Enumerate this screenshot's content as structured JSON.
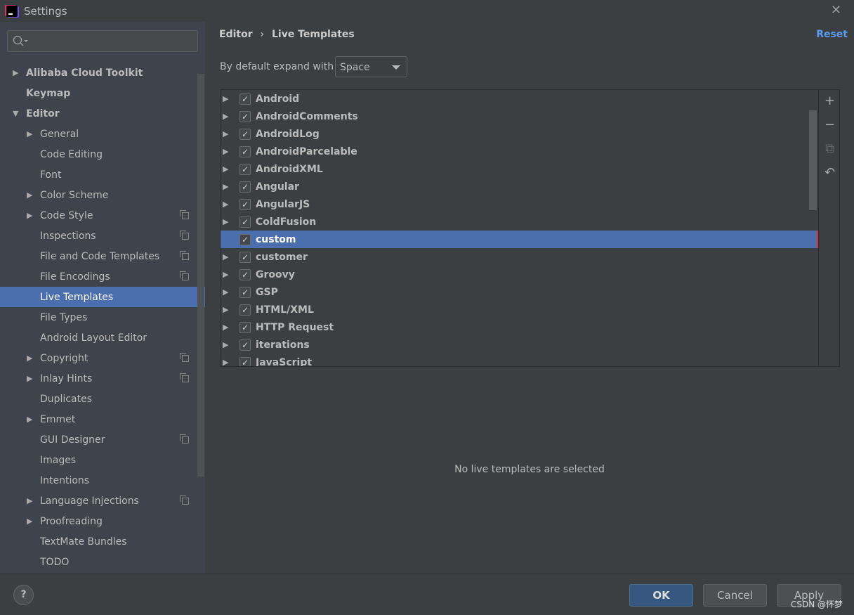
{
  "window": {
    "title": "Settings",
    "close_icon": "close-icon"
  },
  "sidebar": {
    "search_placeholder": "",
    "items": [
      {
        "label": "Alibaba Cloud Toolkit",
        "level": 0,
        "arrow": "right",
        "bold": true
      },
      {
        "label": "Keymap",
        "level": 0,
        "arrow": "",
        "bold": true
      },
      {
        "label": "Editor",
        "level": 0,
        "arrow": "down",
        "bold": true
      },
      {
        "label": "General",
        "level": 1,
        "arrow": "right"
      },
      {
        "label": "Code Editing",
        "level": 1,
        "arrow": ""
      },
      {
        "label": "Font",
        "level": 1,
        "arrow": ""
      },
      {
        "label": "Color Scheme",
        "level": 1,
        "arrow": "right"
      },
      {
        "label": "Code Style",
        "level": 1,
        "arrow": "right",
        "copy": true
      },
      {
        "label": "Inspections",
        "level": 1,
        "arrow": "",
        "copy": true
      },
      {
        "label": "File and Code Templates",
        "level": 1,
        "arrow": "",
        "copy": true
      },
      {
        "label": "File Encodings",
        "level": 1,
        "arrow": "",
        "copy": true
      },
      {
        "label": "Live Templates",
        "level": 1,
        "arrow": "",
        "selected": true
      },
      {
        "label": "File Types",
        "level": 1,
        "arrow": ""
      },
      {
        "label": "Android Layout Editor",
        "level": 1,
        "arrow": ""
      },
      {
        "label": "Copyright",
        "level": 1,
        "arrow": "right",
        "copy": true
      },
      {
        "label": "Inlay Hints",
        "level": 1,
        "arrow": "right",
        "copy": true
      },
      {
        "label": "Duplicates",
        "level": 1,
        "arrow": ""
      },
      {
        "label": "Emmet",
        "level": 1,
        "arrow": "right"
      },
      {
        "label": "GUI Designer",
        "level": 1,
        "arrow": "",
        "copy": true
      },
      {
        "label": "Images",
        "level": 1,
        "arrow": ""
      },
      {
        "label": "Intentions",
        "level": 1,
        "arrow": ""
      },
      {
        "label": "Language Injections",
        "level": 1,
        "arrow": "right",
        "copy": true
      },
      {
        "label": "Proofreading",
        "level": 1,
        "arrow": "right"
      },
      {
        "label": "TextMate Bundles",
        "level": 1,
        "arrow": ""
      },
      {
        "label": "TODO",
        "level": 1,
        "arrow": ""
      }
    ]
  },
  "main": {
    "breadcrumb": {
      "parent": "Editor",
      "separator": "›",
      "current": "Live Templates"
    },
    "reset_label": "Reset",
    "expand_label": "By default expand with",
    "expand_value": "Space",
    "templates": [
      {
        "label": "Android",
        "checked": true
      },
      {
        "label": "AndroidComments",
        "checked": true
      },
      {
        "label": "AndroidLog",
        "checked": true
      },
      {
        "label": "AndroidParcelable",
        "checked": true
      },
      {
        "label": "AndroidXML",
        "checked": true
      },
      {
        "label": "Angular",
        "checked": true
      },
      {
        "label": "AngularJS",
        "checked": true
      },
      {
        "label": "ColdFusion",
        "checked": true
      },
      {
        "label": "custom",
        "checked": true,
        "selected": true
      },
      {
        "label": "customer",
        "checked": true
      },
      {
        "label": "Groovy",
        "checked": true
      },
      {
        "label": "GSP",
        "checked": true
      },
      {
        "label": "HTML/XML",
        "checked": true
      },
      {
        "label": "HTTP Request",
        "checked": true
      },
      {
        "label": "iterations",
        "checked": true
      },
      {
        "label": "JavaScript",
        "checked": true
      }
    ],
    "toolbar": [
      {
        "icon": "plus-icon",
        "glyph": "+"
      },
      {
        "icon": "minus-icon",
        "glyph": "−"
      },
      {
        "icon": "copy-icon",
        "glyph": "⧉"
      },
      {
        "icon": "undo-icon",
        "glyph": "↶"
      }
    ],
    "empty_text": "No live templates are selected"
  },
  "footer": {
    "help": "?",
    "ok": "OK",
    "cancel": "Cancel",
    "apply": "Apply",
    "watermark": "CSDN @怀梦"
  },
  "colors": {
    "selection": "#4b6eaf",
    "link": "#589df6",
    "ok_button": "#365880"
  }
}
